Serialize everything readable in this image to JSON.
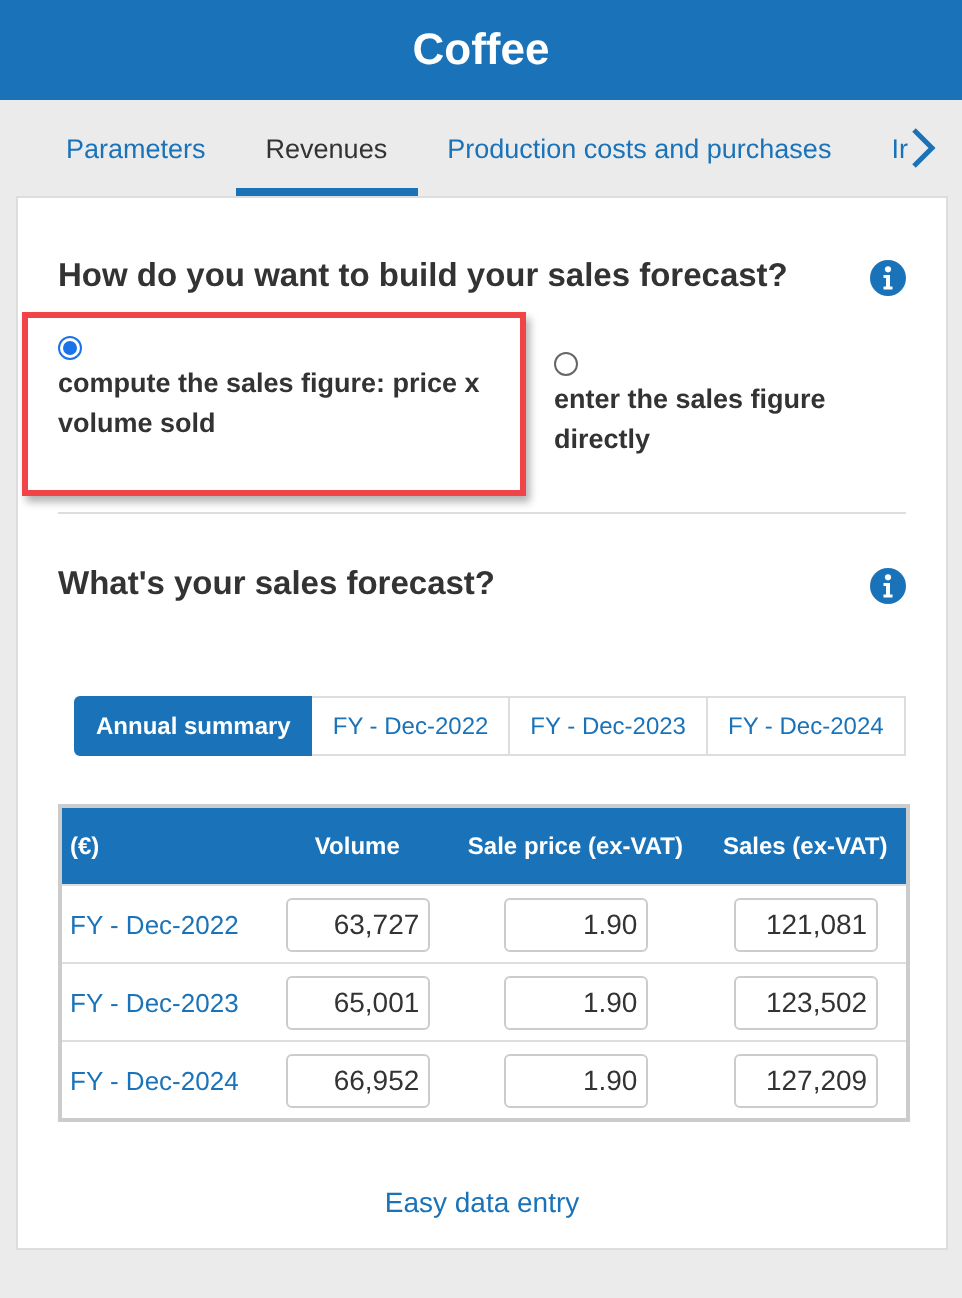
{
  "header": {
    "title": "Coffee"
  },
  "tabs": [
    {
      "label": "Parameters",
      "selected": false
    },
    {
      "label": "Revenues",
      "selected": true
    },
    {
      "label": "Production costs and purchases",
      "selected": false
    },
    {
      "label": "Ir",
      "selected": false
    }
  ],
  "build_section": {
    "title": "How do you want to build your sales forecast?",
    "options": [
      {
        "label": "compute the sales figure: price x volume sold",
        "selected": true,
        "highlighted": true
      },
      {
        "label": "enter the sales figure directly",
        "selected": false,
        "highlighted": false
      }
    ]
  },
  "forecast_section": {
    "title": "What's your sales forecast?",
    "period_tabs": [
      {
        "label": "Annual summary",
        "selected": true
      },
      {
        "label": "FY - Dec-2022",
        "selected": false
      },
      {
        "label": "FY - Dec-2023",
        "selected": false
      },
      {
        "label": "FY - Dec-2024",
        "selected": false
      }
    ],
    "table": {
      "columns": [
        "(€)",
        "Volume",
        "Sale price (ex-VAT)",
        "Sales (ex-VAT)"
      ],
      "rows": [
        {
          "period": "FY - Dec-2022",
          "volume": "63,727",
          "price": "1.90",
          "sales": "121,081"
        },
        {
          "period": "FY - Dec-2023",
          "volume": "65,001",
          "price": "1.90",
          "sales": "123,502"
        },
        {
          "period": "FY - Dec-2024",
          "volume": "66,952",
          "price": "1.90",
          "sales": "127,209"
        }
      ]
    },
    "link": "Easy data entry"
  }
}
